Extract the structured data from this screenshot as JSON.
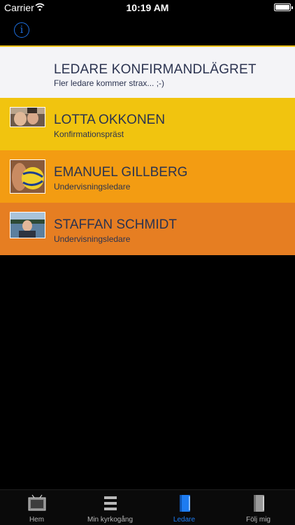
{
  "status_bar": {
    "carrier": "Carrier",
    "time": "10:19 AM"
  },
  "header": {
    "title": "LEDARE KONFIRMANDLÄGRET",
    "subtitle": "Fler ledare kommer strax... ;-)"
  },
  "leaders": [
    {
      "name": "LOTTA OKKONEN",
      "role": "Konfirmationspräst",
      "color": "#f1c40f"
    },
    {
      "name": "EMANUEL GILLBERG",
      "role": "Undervisningsledare",
      "color": "#f39c12"
    },
    {
      "name": "STAFFAN SCHMIDT",
      "role": "Undervisningsledare",
      "color": "#e67e22"
    }
  ],
  "tabs": [
    {
      "label": "Hem",
      "icon": "tv-icon",
      "active": false
    },
    {
      "label": "Min kyrkogång",
      "icon": "list-icon",
      "active": false
    },
    {
      "label": "Ledare",
      "icon": "book-icon",
      "active": true
    },
    {
      "label": "Följ mig",
      "icon": "book-icon",
      "active": false
    }
  ],
  "colors": {
    "accent": "#1d7cf2",
    "text_dark": "#2b3350"
  }
}
